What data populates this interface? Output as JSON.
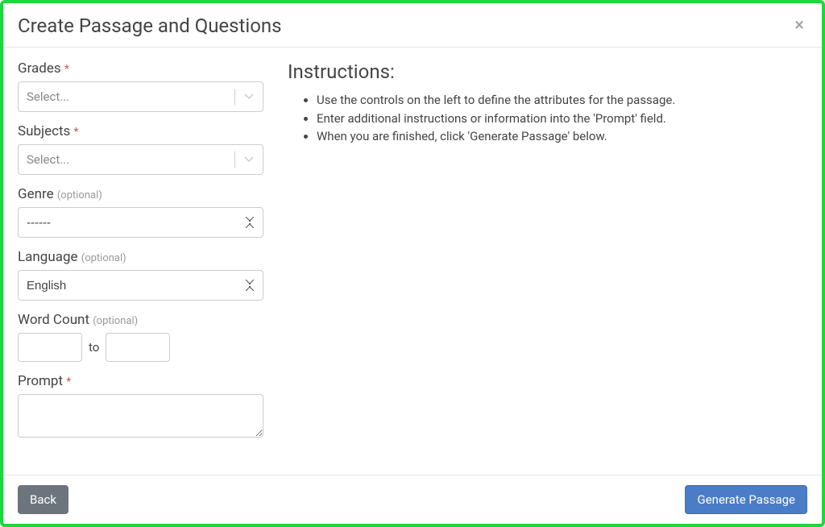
{
  "modal": {
    "title": "Create Passage and Questions",
    "close_label": "×"
  },
  "form": {
    "grades": {
      "label": "Grades",
      "placeholder": "Select..."
    },
    "subjects": {
      "label": "Subjects",
      "placeholder": "Select..."
    },
    "genre": {
      "label": "Genre",
      "optional": "(optional)",
      "value": "------"
    },
    "language": {
      "label": "Language",
      "optional": "(optional)",
      "value": "English"
    },
    "word_count": {
      "label": "Word Count",
      "optional": "(optional)",
      "to": "to"
    },
    "prompt": {
      "label": "Prompt"
    },
    "required_mark": "*"
  },
  "instructions": {
    "title": "Instructions:",
    "items": [
      "Use the controls on the left to define the attributes for the passage.",
      "Enter additional instructions or information into the 'Prompt' field.",
      "When you are finished, click 'Generate Passage' below."
    ]
  },
  "footer": {
    "back": "Back",
    "generate": "Generate Passage"
  }
}
